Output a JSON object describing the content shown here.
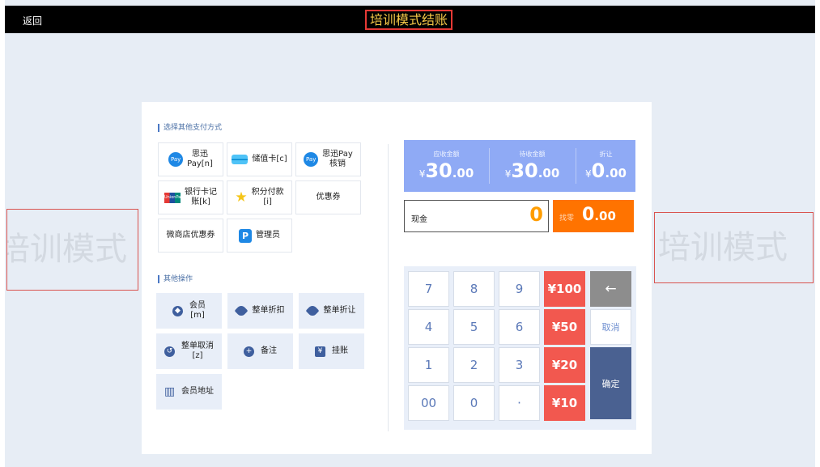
{
  "header": {
    "back_label": "返回",
    "title": "培训模式结账"
  },
  "watermark_text": "培训模式",
  "payment": {
    "section_title": "选择其他支付方式",
    "methods": [
      {
        "label": "思迅\nPay[n]",
        "icon": "pay-icon",
        "icon_text": "Pay"
      },
      {
        "label": "储值卡[c]",
        "icon": "card-icon"
      },
      {
        "label": "思迅Pay\n核销",
        "icon": "pay-icon",
        "icon_text": "Pay"
      },
      {
        "label": "银行卡记\n账[k]",
        "icon": "unionpay-icon",
        "icon_text": "UnionPay"
      },
      {
        "label": "积分付款\n[i]",
        "icon": "star-icon"
      },
      {
        "label": "优惠券",
        "icon": ""
      },
      {
        "label": "微商店优惠券",
        "icon": ""
      },
      {
        "label": "管理员",
        "icon": "paypal-icon",
        "icon_text": "P"
      }
    ]
  },
  "operations": {
    "section_title": "其他操作",
    "items": [
      {
        "label": "会员\n[m]",
        "icon": "member-icon"
      },
      {
        "label": "整单折扣",
        "icon": "tag-icon"
      },
      {
        "label": "整单折让",
        "icon": "tag-icon"
      },
      {
        "label": "整单取消\n[z]",
        "icon": "undo-icon"
      },
      {
        "label": "备注",
        "icon": "plus-icon"
      },
      {
        "label": "挂账",
        "icon": "ledger-icon"
      },
      {
        "label": "会员地址",
        "icon": "building-icon"
      }
    ]
  },
  "amounts": {
    "currency": "¥",
    "receivable": {
      "label": "应收金额",
      "int": "30",
      "dec": ".00"
    },
    "pending": {
      "label": "待收金额",
      "int": "30",
      "dec": ".00"
    },
    "discount": {
      "label": "折让",
      "int": "0",
      "dec": ".00"
    }
  },
  "cash": {
    "label": "现金",
    "value": "0"
  },
  "change": {
    "label": "找零",
    "int": "0",
    "dec": ".00"
  },
  "keypad": {
    "digits": [
      "7",
      "8",
      "9",
      "4",
      "5",
      "6",
      "1",
      "2",
      "3",
      "00",
      "0",
      "·"
    ],
    "quick": [
      "¥100",
      "¥50",
      "¥20",
      "¥10"
    ],
    "backspace": "←",
    "cancel": "取消",
    "confirm": "确定"
  },
  "colors": {
    "accent": "#8faaf5",
    "change_bg": "#ff7300",
    "quick_key": "#f2584f",
    "confirm": "#4a6191",
    "title": "#f7c948"
  }
}
